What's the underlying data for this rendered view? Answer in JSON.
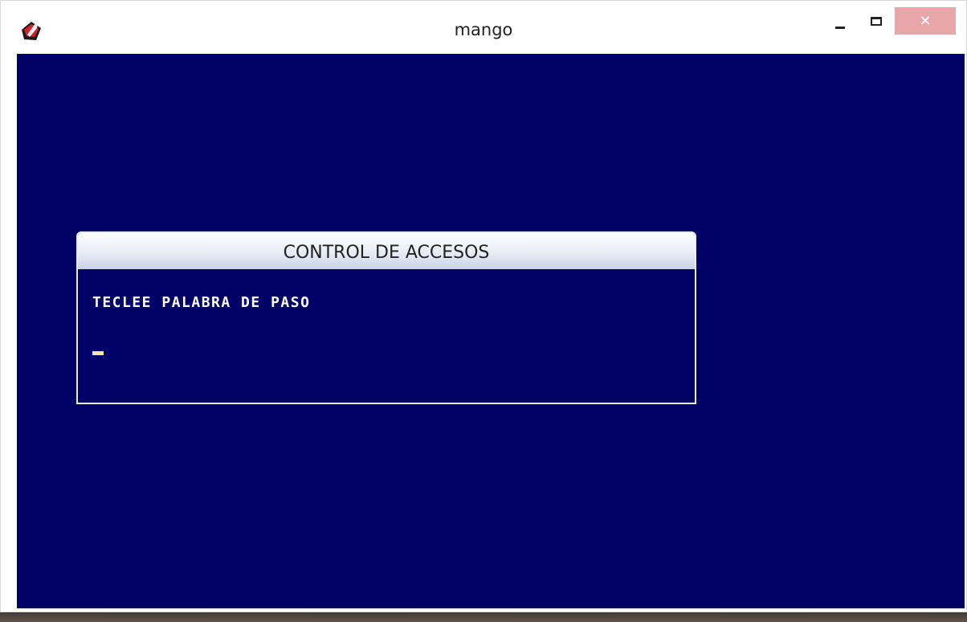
{
  "window": {
    "title": "mango",
    "close_symbol": "✕"
  },
  "icons": {
    "app": "mango-app-icon",
    "minimize": "minimize-icon",
    "maximize": "maximize-icon",
    "close": "close-icon"
  },
  "colors": {
    "console_background": "#000066",
    "dialog_border": "#e8ecf3",
    "prompt_text": "#ffffff",
    "cursor": "#f4e99a",
    "close_button": "#e8a5aa"
  },
  "dialog": {
    "title": "CONTROL DE ACCESOS",
    "prompt": "TECLEE PALABRA DE PASO",
    "password_value": ""
  }
}
